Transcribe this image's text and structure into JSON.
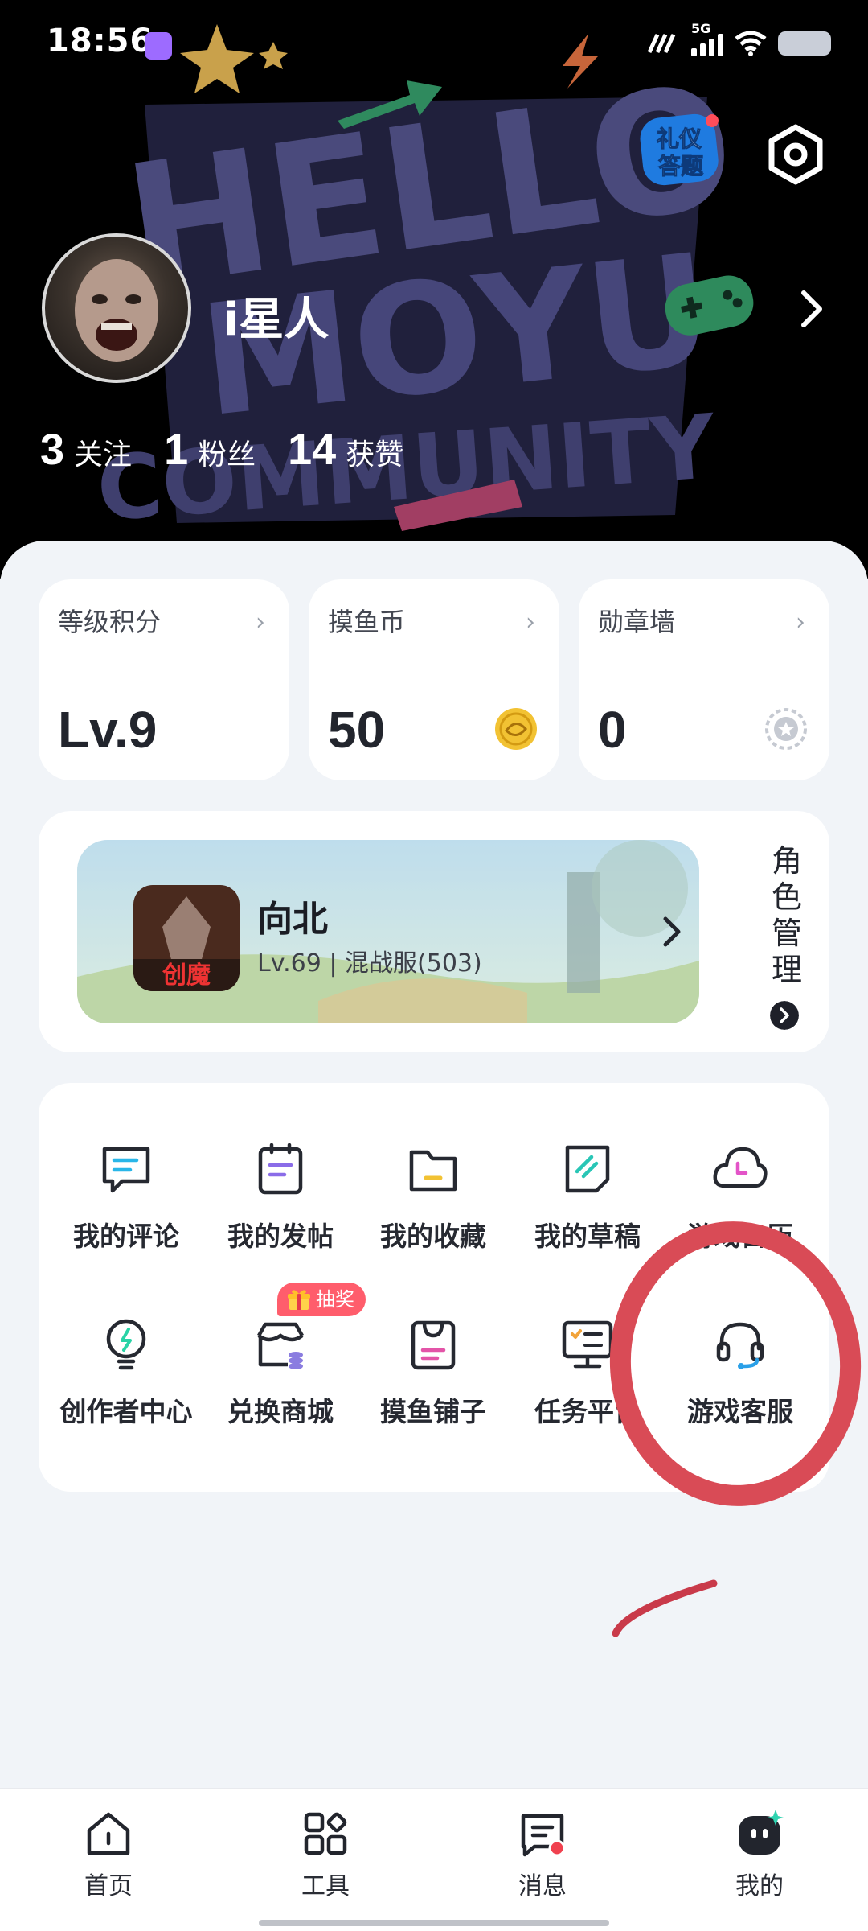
{
  "status_bar": {
    "time": "18:56",
    "network": "5G"
  },
  "header": {
    "background_text": [
      "HELLO",
      "MOYU",
      "COMMUNITY"
    ],
    "quiz_badge": [
      "礼仪",
      "答题"
    ],
    "username": "i星人",
    "stats": [
      {
        "value": "3",
        "label": "关注"
      },
      {
        "value": "1",
        "label": "粉丝"
      },
      {
        "value": "14",
        "label": "获赞"
      }
    ]
  },
  "cards": [
    {
      "title": "等级积分",
      "value": "Lv.9",
      "icon": "none"
    },
    {
      "title": "摸鱼币",
      "value": "50",
      "icon": "coin-icon"
    },
    {
      "title": "勋章墙",
      "value": "0",
      "icon": "medal-icon"
    }
  ],
  "role": {
    "game_icon_text": "创魔",
    "name": "向北",
    "info": "Lv.69 | 混战服(503)",
    "manage_label": [
      "角",
      "色",
      "管",
      "理"
    ]
  },
  "grid": {
    "items": [
      {
        "label": "我的评论",
        "icon": "comment-icon"
      },
      {
        "label": "我的发帖",
        "icon": "post-icon"
      },
      {
        "label": "我的收藏",
        "icon": "folder-icon"
      },
      {
        "label": "我的草稿",
        "icon": "draft-icon"
      },
      {
        "label": "游戏日历",
        "icon": "cloud-clock-icon"
      },
      {
        "label": "创作者中心",
        "icon": "lightbulb-icon"
      },
      {
        "label": "兑换商城",
        "icon": "shop-icon"
      },
      {
        "label": "摸鱼铺子",
        "icon": "bag-icon"
      },
      {
        "label": "任务平台",
        "icon": "task-icon"
      },
      {
        "label": "游戏客服",
        "icon": "headset-icon"
      }
    ],
    "lottery_badge": "抽奖"
  },
  "tabbar": {
    "tabs": [
      {
        "label": "首页",
        "icon": "home-icon"
      },
      {
        "label": "工具",
        "icon": "tools-icon"
      },
      {
        "label": "消息",
        "icon": "message-icon"
      },
      {
        "label": "我的",
        "icon": "profile-icon",
        "active": true
      }
    ]
  },
  "colors": {
    "accent": "#6d5bd0",
    "coin": "#f2c233",
    "badge": "#ff5d6c",
    "annotation": "#d94b56"
  }
}
